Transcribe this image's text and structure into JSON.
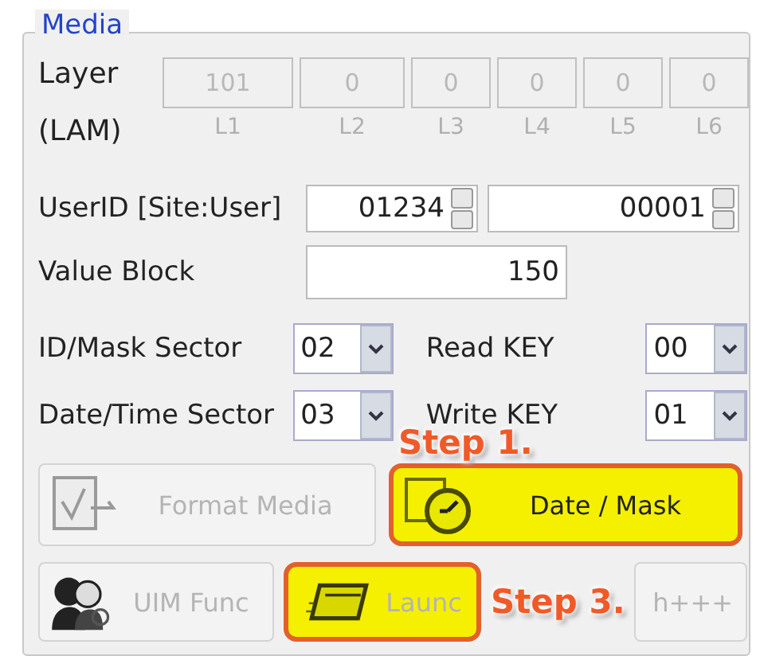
{
  "group": {
    "title": "Media"
  },
  "layer": {
    "label": "Layer",
    "sublabel": "(LAM)",
    "fields": [
      {
        "value": "101",
        "caption": "L1",
        "disabled": true
      },
      {
        "value": "0",
        "caption": "L2",
        "disabled": true
      },
      {
        "value": "0",
        "caption": "L3",
        "disabled": true
      },
      {
        "value": "0",
        "caption": "L4",
        "disabled": true
      },
      {
        "value": "0",
        "caption": "L5",
        "disabled": true
      },
      {
        "value": "0",
        "caption": "L6",
        "disabled": true
      }
    ]
  },
  "user_id": {
    "label": "UserID [Site:User]",
    "site": "01234",
    "user": "00001"
  },
  "value_block": {
    "label": "Value Block",
    "value": "150"
  },
  "sectors": [
    {
      "label": "ID/Mask Sector",
      "value": "02",
      "key_label": "Read KEY",
      "key_value": "00"
    },
    {
      "label": "Date/Time Sector",
      "value": "03",
      "key_label": "Write KEY",
      "key_value": "01"
    }
  ],
  "buttons": [
    {
      "kind": "format",
      "label": "Format Media",
      "disabled": true,
      "highlighted": false
    },
    {
      "kind": "clock",
      "label": "Date / Mask",
      "disabled": false,
      "highlighted": true
    },
    {
      "kind": "people",
      "label": "UIM Func",
      "disabled": true,
      "highlighted": false
    },
    {
      "kind": "card",
      "label": "Launc",
      "disabled": true,
      "highlighted": true
    },
    {
      "kind": "blank",
      "label": "h+++",
      "disabled": true,
      "highlighted": false
    }
  ],
  "callouts": [
    {
      "text": "Step 1."
    },
    {
      "text": "Step 3."
    }
  ]
}
